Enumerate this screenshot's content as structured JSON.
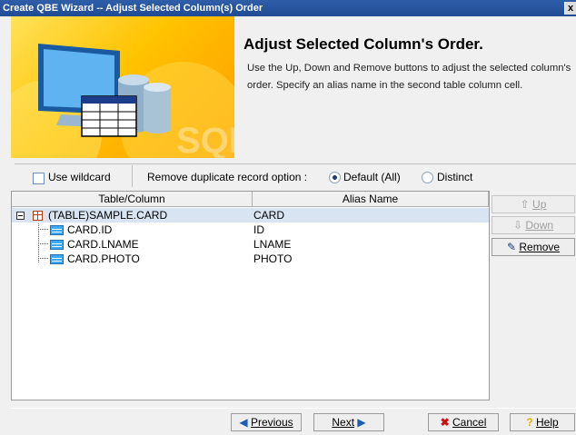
{
  "window": {
    "title": "Create QBE Wizard -- Adjust Selected Column(s) Order",
    "close_glyph": "x"
  },
  "banner": {
    "watermark": "SQL"
  },
  "header": {
    "heading": "Adjust Selected Column's Order.",
    "description": "Use the Up, Down and Remove buttons to adjust the selected column's order. Specify an alias name in the second table column cell."
  },
  "options": {
    "use_wildcard_label": "Use wildcard",
    "use_wildcard_checked": false,
    "duplicate_label": "Remove duplicate record option :",
    "radio_default_label": "Default (All)",
    "radio_distinct_label": "Distinct",
    "selected": "Default (All)"
  },
  "table": {
    "headers": [
      "Table/Column",
      "Alias Name"
    ],
    "rows": [
      {
        "name": "(TABLE)SAMPLE.CARD",
        "alias": "CARD",
        "kind": "table",
        "selected": true
      },
      {
        "name": "CARD.ID",
        "alias": "ID",
        "kind": "column",
        "selected": false
      },
      {
        "name": "CARD.LNAME",
        "alias": "LNAME",
        "kind": "column",
        "selected": false
      },
      {
        "name": "CARD.PHOTO",
        "alias": "PHOTO",
        "kind": "column",
        "selected": false
      }
    ]
  },
  "side_buttons": {
    "up": {
      "label": "Up",
      "icon": "arrow-up-icon",
      "enabled": false
    },
    "down": {
      "label": "Down",
      "icon": "arrow-down-icon",
      "enabled": false
    },
    "remove": {
      "label": "Remove",
      "icon": "remove-icon",
      "enabled": true
    }
  },
  "footer": {
    "previous": "Previous",
    "next": "Next",
    "cancel": "Cancel",
    "help": "Help"
  },
  "colors": {
    "titlebar": "#1f4c94",
    "selection": "#d8e4f2",
    "cancel_icon": "#d01010",
    "help_icon": "#e0b000"
  }
}
